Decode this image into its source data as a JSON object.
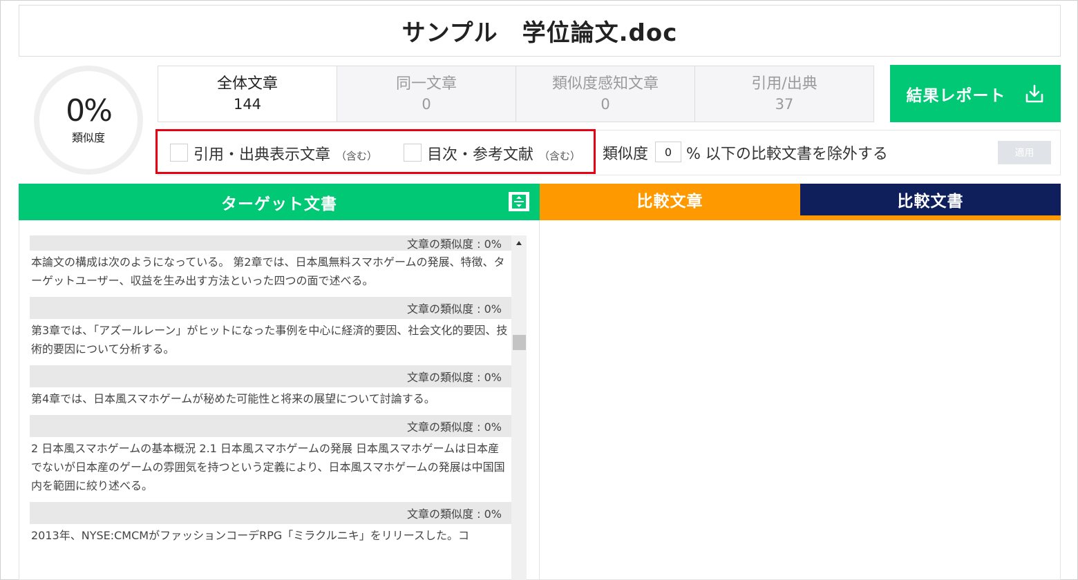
{
  "document": {
    "title": "サンプル　学位論文.doc"
  },
  "similarity": {
    "percent": "0%",
    "label": "類似度"
  },
  "stats": [
    {
      "label": "全体文章",
      "value": "144"
    },
    {
      "label": "同一文章",
      "value": "0"
    },
    {
      "label": "類似度感知文章",
      "value": "0"
    },
    {
      "label": "引用/出典",
      "value": "37"
    }
  ],
  "report_button": {
    "label": "結果レポート",
    "icon": "download-icon"
  },
  "filters": {
    "option1": {
      "label": "引用・出典表示文章",
      "note": "（含む）"
    },
    "option2": {
      "label": "目次・参考文献",
      "note": "（含む）"
    },
    "threshold_label": "類似度",
    "threshold_value": "0",
    "threshold_suffix": "% 以下の比較文書を除外する",
    "apply_label": "適用"
  },
  "panels": {
    "target_title": "ターゲット文書",
    "compare_sentence_tab": "比較文章",
    "compare_doc_tab": "比較文書"
  },
  "sentences": [
    {
      "similarity": "文章の類似度 : 0%",
      "text": "本論文の構成は次のようになっている。 第2章では、日本風無料スマホゲームの発展、特徴、ターゲットユーザー、収益を生み出す方法といった四つの面で述べる。"
    },
    {
      "similarity": "文章の類似度 : 0%",
      "text": "第3章では、「アズールレーン」がヒットになった事例を中心に経済的要因、社会文化的要因、技術的要因について分析する。"
    },
    {
      "similarity": "文章の類似度 : 0%",
      "text": "第4章では、日本風スマホゲームが秘めた可能性と将来の展望について討論する。"
    },
    {
      "similarity": "文章の類似度 : 0%",
      "text": "2 日本風スマホゲームの基本概況 2.1 日本風スマホゲームの発展 日本風スマホゲームは日本産でないが日本産のゲームの雰囲気を持つという定義により、日本風スマホゲームの発展は中国国内を範囲に絞り述べる。"
    },
    {
      "similarity": "文章の類似度 : 0%",
      "text": "2013年、NYSE:CMCMがファッションコーデRPG「ミラクルニキ」をリリースした。コ"
    }
  ]
}
